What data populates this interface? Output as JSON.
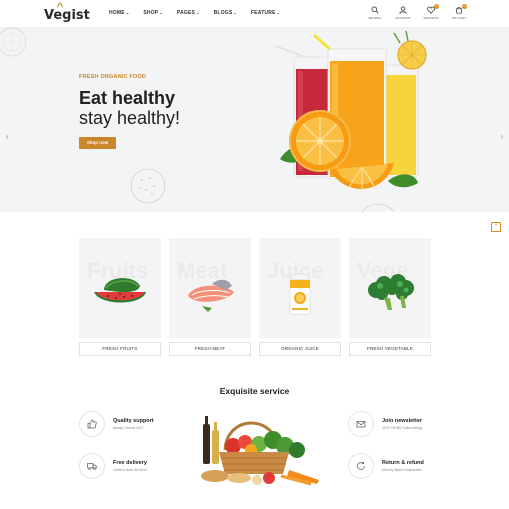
{
  "header": {
    "logo": "Vegist",
    "nav": [
      {
        "label": "HOME"
      },
      {
        "label": "SHOP"
      },
      {
        "label": "PAGES"
      },
      {
        "label": "BLOGS"
      },
      {
        "label": "FEATURE"
      }
    ],
    "icons": [
      {
        "name": "search-icon",
        "label": "SEARCH"
      },
      {
        "name": "account-icon",
        "label": "ACCOUNT"
      },
      {
        "name": "wishlist-icon",
        "label": "WISHLIST",
        "badge": "0"
      },
      {
        "name": "cart-icon",
        "label": "MY CART",
        "badge": "0"
      }
    ],
    "accent": "#c9862a"
  },
  "hero": {
    "kicker": "FRESH ORGANIC FOOD",
    "title": "Eat healthy",
    "subtitle": "stay healthy!",
    "button": "Shop now",
    "prev_icon": "chevron-left-icon",
    "next_icon": "chevron-right-icon"
  },
  "categories": [
    {
      "bg_text": "Fruits",
      "label": "FRESH FRUITS",
      "icon": "watermelon"
    },
    {
      "bg_text": "Meat",
      "label": "FRESH MEAT",
      "icon": "salmon"
    },
    {
      "bg_text": "Juice",
      "label": "ORGANIC JUICE",
      "icon": "juice-carton"
    },
    {
      "bg_text": "Vege",
      "label": "FRESH VEGETABLE",
      "icon": "broccoli"
    }
  ],
  "service": {
    "title": "Exquisite service",
    "items": [
      {
        "name": "Quality support",
        "desc": "Alway Online 24/7",
        "icon": "thumbs-up-icon"
      },
      {
        "name": "Free delivery",
        "desc": "Orders from All Item",
        "icon": "truck-icon"
      },
      {
        "name": "Join newsletter",
        "desc": "20% Off By Subscribing",
        "icon": "mail-icon"
      },
      {
        "name": "Return & refund",
        "desc": "Money Back Guarantee",
        "icon": "refund-icon"
      }
    ]
  }
}
